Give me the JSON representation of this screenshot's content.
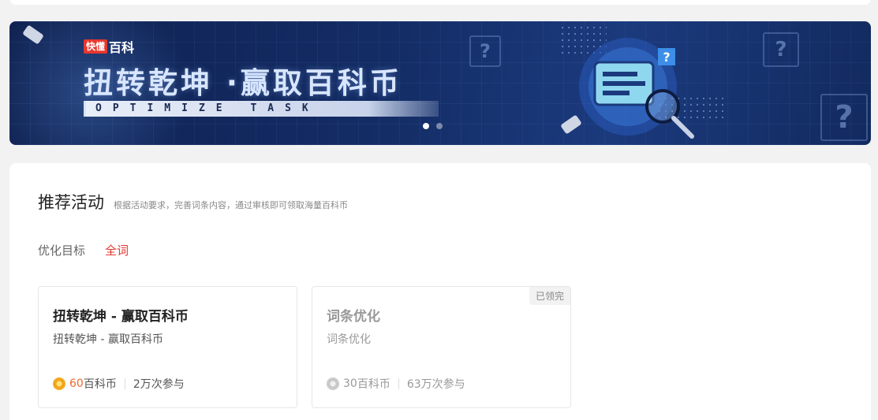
{
  "banner": {
    "brand_tag": "快懂",
    "brand_name": "百科",
    "title": "扭转乾坤 ·赢取百科币",
    "subtitle": "OPTIMIZE TASK",
    "carousel": {
      "count": 2,
      "active": 1
    }
  },
  "section": {
    "title": "推荐活动",
    "description": "根据活动要求，完善词条内容，通过审核即可领取海量百科币"
  },
  "filter": {
    "label": "优化目标",
    "selected": "全词"
  },
  "cards": [
    {
      "title": "扭转乾坤 - 赢取百科币",
      "description": "扭转乾坤 - 赢取百科币",
      "reward_amount": "60",
      "reward_unit": "百科币",
      "participants": "2万次参与",
      "claimed": false,
      "coin_icon": "gold-coin-icon"
    },
    {
      "title": "词条优化",
      "description": "词条优化",
      "reward_amount": "30",
      "reward_unit": "百科币",
      "participants": "63万次参与",
      "claimed": true,
      "badge": "已领完",
      "coin_icon": "grey-coin-icon"
    }
  ],
  "colors": {
    "accent": "#e0362f",
    "reward": "#f06a2b",
    "banner_bg": "#142d66"
  }
}
